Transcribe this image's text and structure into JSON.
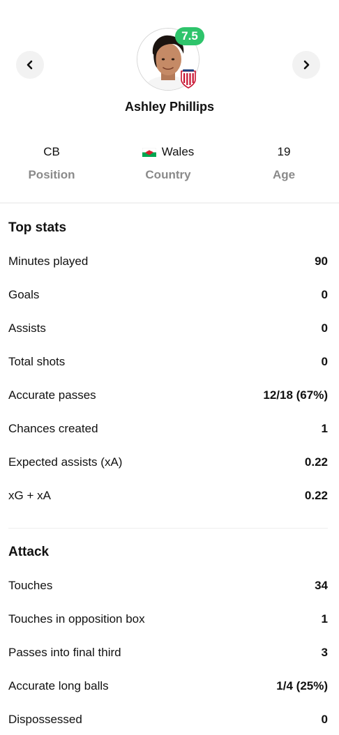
{
  "player": {
    "name": "Ashley Phillips",
    "rating": "7.5"
  },
  "info": [
    {
      "value": "CB",
      "label": "Position"
    },
    {
      "value": "Wales",
      "label": "Country"
    },
    {
      "value": "19",
      "label": "Age"
    }
  ],
  "top_stats": {
    "title": "Top stats",
    "rows": [
      {
        "label": "Minutes played",
        "value": "90"
      },
      {
        "label": "Goals",
        "value": "0"
      },
      {
        "label": "Assists",
        "value": "0"
      },
      {
        "label": "Total shots",
        "value": "0"
      },
      {
        "label": "Accurate passes",
        "value": "12/18 (67%)"
      },
      {
        "label": "Chances created",
        "value": "1"
      },
      {
        "label": "Expected assists (xA)",
        "value": "0.22"
      },
      {
        "label": "xG + xA",
        "value": "0.22"
      }
    ]
  },
  "attack": {
    "title": "Attack",
    "rows": [
      {
        "label": "Touches",
        "value": "34"
      },
      {
        "label": "Touches in opposition box",
        "value": "1"
      },
      {
        "label": "Passes into final third",
        "value": "3"
      },
      {
        "label": "Accurate long balls",
        "value": "1/4 (25%)"
      },
      {
        "label": "Dispossessed",
        "value": "0"
      }
    ]
  },
  "colors": {
    "rating_badge": "#2ec46b",
    "muted_label": "#8a8a8a",
    "nav_button_bg": "#f2f2f2"
  },
  "icons": {
    "prev": "chevron-left-icon",
    "next": "chevron-right-icon",
    "flag": "wales-flag-icon",
    "club": "club-crest-icon"
  }
}
